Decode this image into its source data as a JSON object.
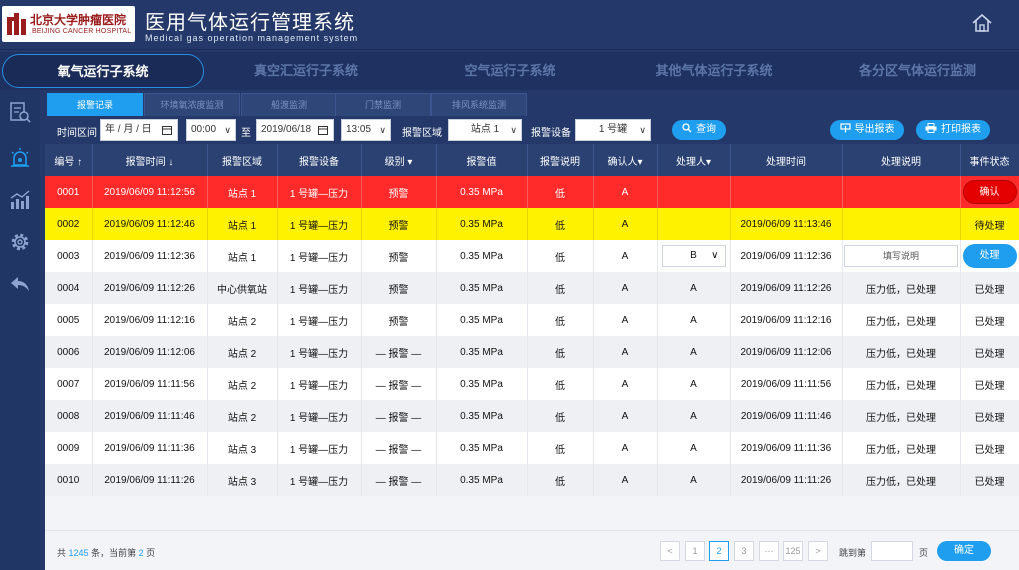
{
  "header": {
    "logo_cn": "北京大学肿瘤医院",
    "logo_en": "BEIJING CANCER HOSPITAL",
    "title_cn": "医用气体运行管理系统",
    "title_en": "Medical gas operation management system"
  },
  "subnav": [
    "氧气运行子系统",
    "真空汇运行子系统",
    "空气运行子系统",
    "其他气体运行子系统",
    "各分区气体运行监测"
  ],
  "tabs": [
    "报警记录",
    "环境氧浓度监测",
    "船渡监测",
    "门禁监测",
    "排风系统监测"
  ],
  "filters": {
    "time_label": "时间区间",
    "date_start": "年 / 月 / 日",
    "time_start": "00:00",
    "to_label": "至",
    "date_end": "2019/06/18",
    "time_end": "13:05",
    "area_label": "报警区域",
    "area_value": "站点 1",
    "device_label": "报警设备",
    "device_value": "1 号罐",
    "search_label": "查询",
    "export_label": "导出报表",
    "print_label": "打印报表"
  },
  "table": {
    "headers": [
      "编号 ↑",
      "报警时间 ↓",
      "报警区域",
      "报警设备",
      "级别 ▾",
      "报警值",
      "报警说明",
      "确认人▾",
      "处理人▾",
      "处理时间",
      "处理说明",
      "事件状态"
    ],
    "rows": [
      {
        "id": "0001",
        "time": "2019/06/09  11:12:56",
        "area": "站点 1",
        "device": "1 号罐—压力",
        "level": "预警",
        "value": "0.35 MPa",
        "desc": "低",
        "confirmer": "A",
        "handler": "",
        "handle_time": "",
        "handle_desc": "",
        "status": "确认"
      },
      {
        "id": "0002",
        "time": "2019/06/09  11:12:46",
        "area": "站点 1",
        "device": "1 号罐—压力",
        "level": "预警",
        "value": "0.35 MPa",
        "desc": "低",
        "confirmer": "A",
        "handler": "",
        "handle_time": "2019/06/09  11:13:46",
        "handle_desc": "",
        "status": "待处理"
      },
      {
        "id": "0003",
        "time": "2019/06/09  11:12:36",
        "area": "站点 1",
        "device": "1 号罐—压力",
        "level": "预警",
        "value": "0.35 MPa",
        "desc": "低",
        "confirmer": "A",
        "handler": "B",
        "handle_time": "2019/06/09  11:12:36",
        "handle_desc": "填写说明",
        "status": "处理"
      },
      {
        "id": "0004",
        "time": "2019/06/09  11:12:26",
        "area": "中心供氧站",
        "device": "1 号罐—压力",
        "level": "预警",
        "value": "0.35 MPa",
        "desc": "低",
        "confirmer": "A",
        "handler": "A",
        "handle_time": "2019/06/09  11:12:26",
        "handle_desc": "压力低，已处理",
        "status": "已处理"
      },
      {
        "id": "0005",
        "time": "2019/06/09  11:12:16",
        "area": "站点 2",
        "device": "1 号罐—压力",
        "level": "预警",
        "value": "0.35 MPa",
        "desc": "低",
        "confirmer": "A",
        "handler": "A",
        "handle_time": "2019/06/09  11:12:16",
        "handle_desc": "压力低，已处理",
        "status": "已处理"
      },
      {
        "id": "0006",
        "time": "2019/06/09  11:12:06",
        "area": "站点 2",
        "device": "1 号罐—压力",
        "level": "— 报警 —",
        "value": "0.35 MPa",
        "desc": "低",
        "confirmer": "A",
        "handler": "A",
        "handle_time": "2019/06/09  11:12:06",
        "handle_desc": "压力低，已处理",
        "status": "已处理"
      },
      {
        "id": "0007",
        "time": "2019/06/09  11:11:56",
        "area": "站点 2",
        "device": "1 号罐—压力",
        "level": "— 报警 —",
        "value": "0.35 MPa",
        "desc": "低",
        "confirmer": "A",
        "handler": "A",
        "handle_time": "2019/06/09  11:11:56",
        "handle_desc": "压力低，已处理",
        "status": "已处理"
      },
      {
        "id": "0008",
        "time": "2019/06/09  11:11:46",
        "area": "站点 2",
        "device": "1 号罐—压力",
        "level": "— 报警 —",
        "value": "0.35 MPa",
        "desc": "低",
        "confirmer": "A",
        "handler": "A",
        "handle_time": "2019/06/09  11:11:46",
        "handle_desc": "压力低，已处理",
        "status": "已处理"
      },
      {
        "id": "0009",
        "time": "2019/06/09  11:11:36",
        "area": "站点 3",
        "device": "1 号罐—压力",
        "level": "— 报警 —",
        "value": "0.35 MPa",
        "desc": "低",
        "confirmer": "A",
        "handler": "A",
        "handle_time": "2019/06/09  11:11:36",
        "handle_desc": "压力低，已处理",
        "status": "已处理"
      },
      {
        "id": "0010",
        "time": "2019/06/09  11:11:26",
        "area": "站点 3",
        "device": "1 号罐—压力",
        "level": "— 报警 —",
        "value": "0.35 MPa",
        "desc": "低",
        "confirmer": "A",
        "handler": "A",
        "handle_time": "2019/06/09  11:11:26",
        "handle_desc": "压力低，已处理",
        "status": "已处理"
      }
    ]
  },
  "footer": {
    "total_prefix": "共",
    "total_count": "1245",
    "total_mid": "条，当前第",
    "current_page": "2",
    "total_suffix": "页",
    "pages": [
      "<",
      "1",
      "2",
      "3",
      "···",
      "125",
      ">"
    ],
    "jump_label": "跳到第",
    "jump_suffix": "页",
    "confirm_label": "确定"
  },
  "colors": {
    "header_bg": "#24396a",
    "accent": "#1f9ef0",
    "alarm_red": "#ff2a2a",
    "warning_yellow": "#fff200"
  }
}
